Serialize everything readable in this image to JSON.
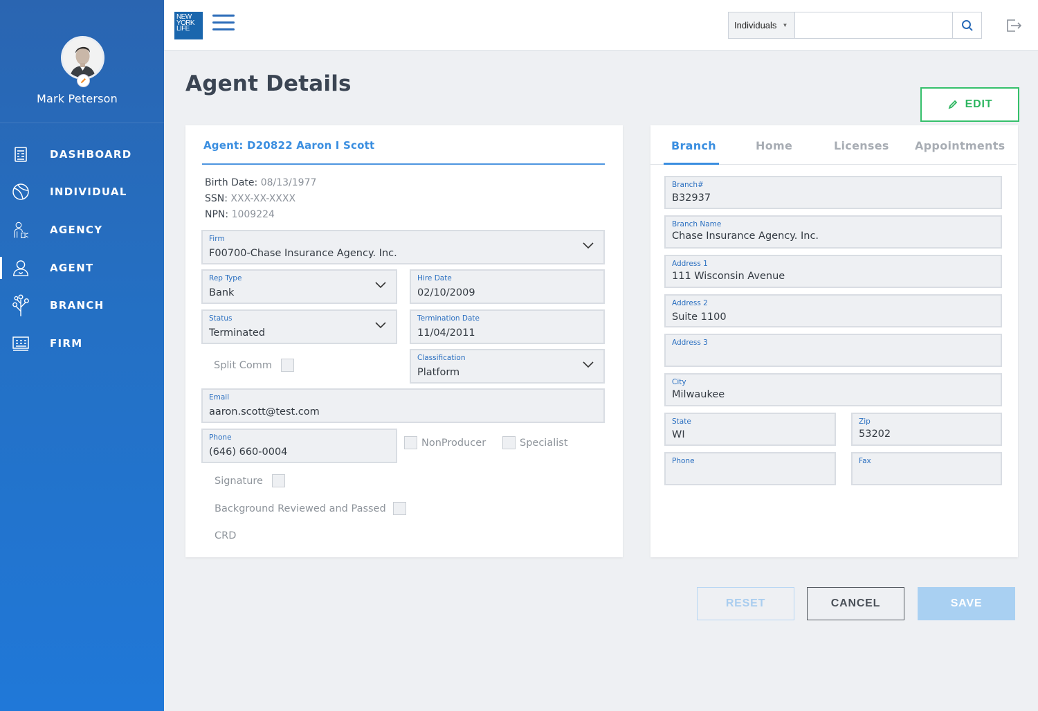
{
  "sidebar": {
    "user_name": "Mark Peterson",
    "items": [
      {
        "label": "DASHBOARD",
        "icon": "dashboard-icon"
      },
      {
        "label": "INDIVIDUAL",
        "icon": "globe-icon"
      },
      {
        "label": "AGENCY",
        "icon": "agency-icon"
      },
      {
        "label": "AGENT",
        "icon": "person-icon",
        "active": true
      },
      {
        "label": "BRANCH",
        "icon": "branch-tree-icon"
      },
      {
        "label": "FIRM",
        "icon": "firm-grid-icon"
      }
    ]
  },
  "topbar": {
    "logo_text": [
      "NEW",
      "YORK",
      "LIFE"
    ],
    "search_scope": "Individuals",
    "search_placeholder": "",
    "search_icon": "search-icon",
    "logout_icon": "logout-icon"
  },
  "page": {
    "title": "Agent Details",
    "edit_label": "EDIT"
  },
  "agent": {
    "title": "Agent: D20822 Aaron I Scott",
    "birth_label": "Birth Date:",
    "birth_value": "08/13/1977",
    "ssn_label": "SSN:",
    "ssn_value": "XXX-XX-XXXX",
    "npn_label": "NPN:",
    "npn_value": "1009224",
    "firm": {
      "label": "Firm",
      "value": "F00700-Chase Insurance Agency. Inc."
    },
    "rep_type": {
      "label": "Rep Type",
      "value": "Bank"
    },
    "hire_date": {
      "label": "Hire Date",
      "value": "02/10/2009"
    },
    "status": {
      "label": "Status",
      "value": "Terminated"
    },
    "termination_date": {
      "label": "Termination Date",
      "value": "11/04/2011"
    },
    "split_comm": "Split Comm",
    "classification": {
      "label": "Classification",
      "value": "Platform"
    },
    "email": {
      "label": "Email",
      "value": "aaron.scott@test.com"
    },
    "phone": {
      "label": "Phone",
      "value": "(646) 660-0004"
    },
    "nonproducer": "NonProducer",
    "specialist": "Specialist",
    "signature": "Signature",
    "background": "Background Reviewed and Passed",
    "crd": "CRD"
  },
  "branch_panel": {
    "tabs": [
      "Branch",
      "Home",
      "Licenses",
      "Appointments"
    ],
    "active_tab": "Branch",
    "branch_no": {
      "label": "Branch#",
      "value": "B32937"
    },
    "branch_name": {
      "label": "Branch Name",
      "value": "Chase Insurance Agency. Inc."
    },
    "address1": {
      "label": "Address 1",
      "value": "111 Wisconsin Avenue"
    },
    "address2": {
      "label": "Address 2",
      "value": "Suite 1100"
    },
    "address3": {
      "label": "Address 3",
      "value": ""
    },
    "city": {
      "label": "City",
      "value": "Milwaukee"
    },
    "state": {
      "label": "State",
      "value": "WI"
    },
    "zip": {
      "label": "Zip",
      "value": "53202"
    },
    "phone": {
      "label": "Phone",
      "value": ""
    },
    "fax": {
      "label": "Fax",
      "value": ""
    }
  },
  "actions": {
    "reset": "RESET",
    "cancel": "CANCEL",
    "save": "SAVE"
  },
  "colors": {
    "sidebar_top": "#2a65b1",
    "sidebar_bottom": "#2078d8",
    "accent_blue": "#3a8ee0",
    "edit_green": "#35c06b",
    "save_disabled": "#a9d0f2"
  }
}
